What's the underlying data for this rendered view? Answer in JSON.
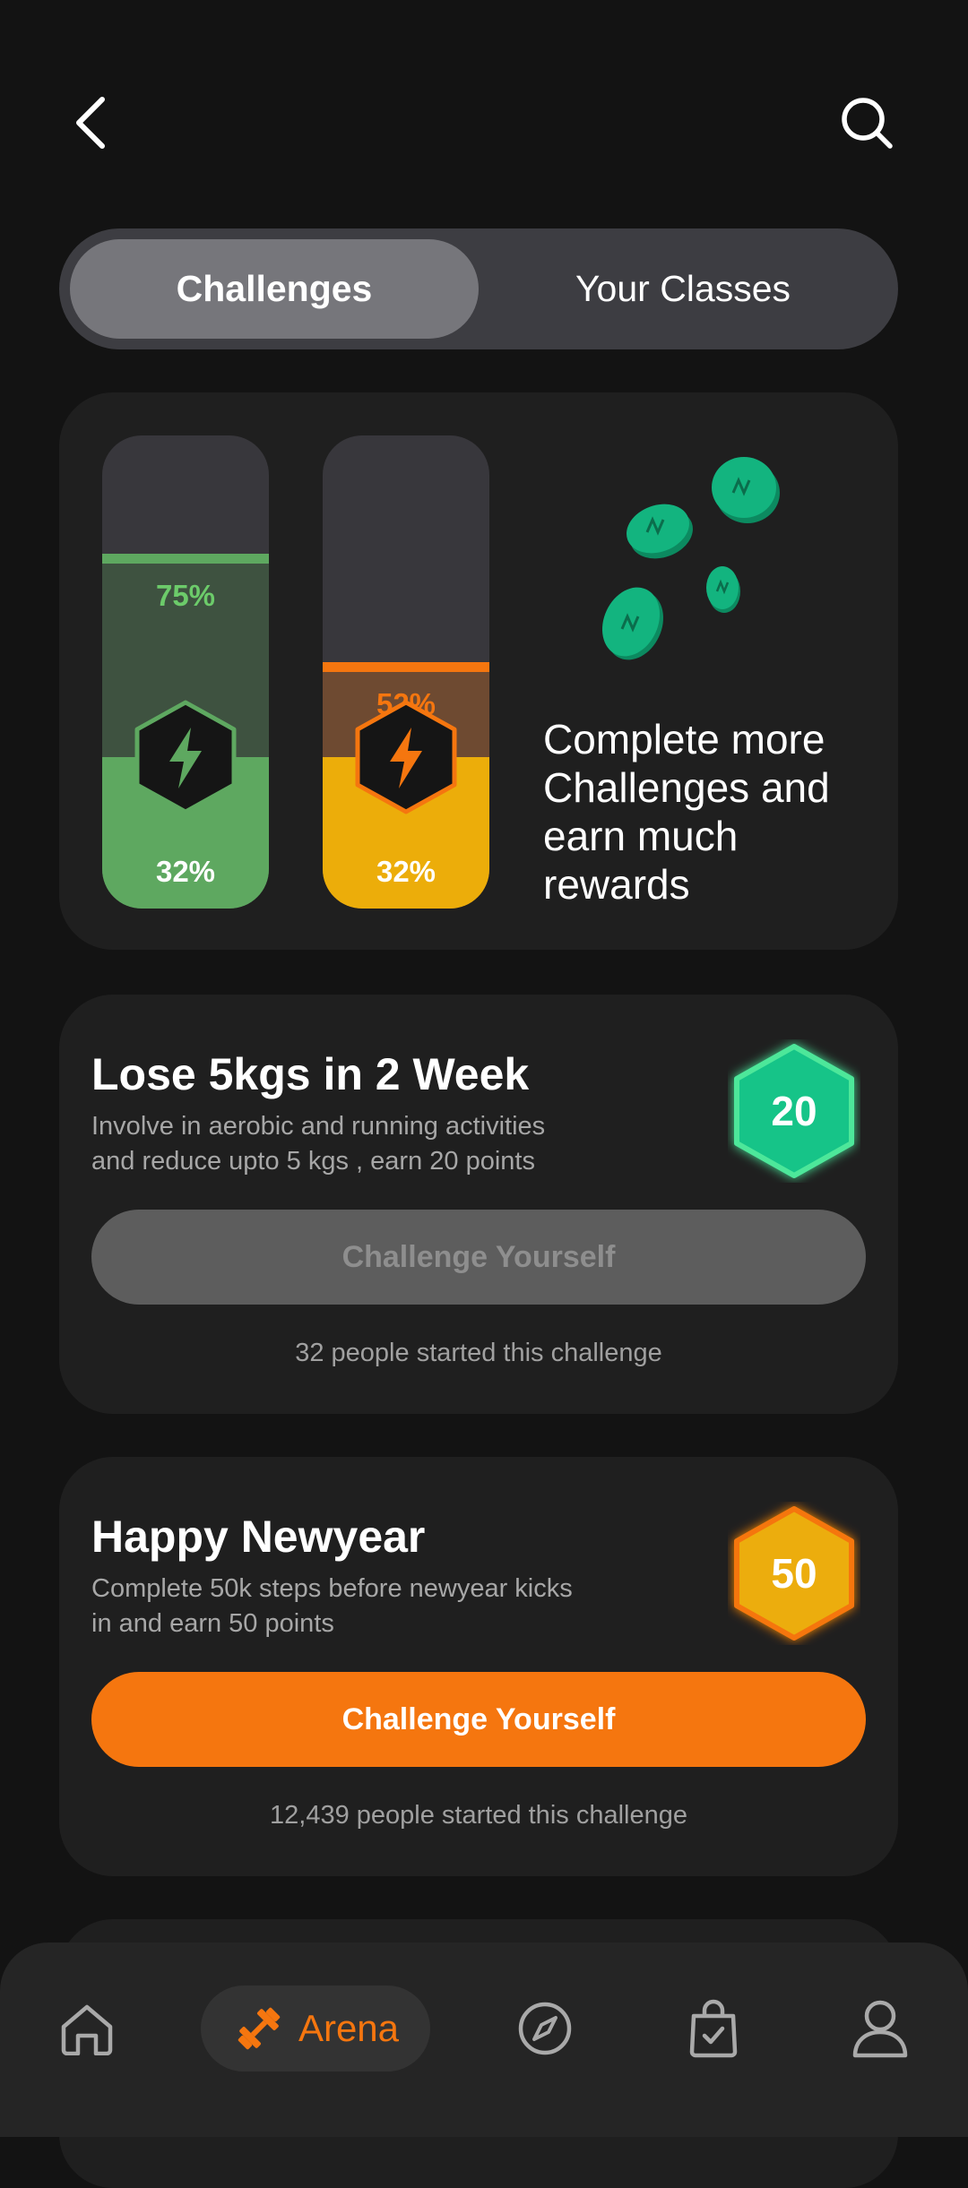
{
  "header": {
    "back_icon": "chevron-left-icon",
    "search_icon": "search-icon"
  },
  "tabs": [
    {
      "label": "Challenges",
      "active": true
    },
    {
      "label": "Your Classes",
      "active": false
    }
  ],
  "progress_card": {
    "bars": [
      {
        "goal_label": "75%",
        "goal_fraction": 0.75,
        "current_label": "32%",
        "current_fraction": 0.32,
        "color": "#5ea860",
        "goal_color": "#3e5240",
        "line_color": "#5ea860",
        "goal_text_color": "#6ccb6a",
        "icon": "lightning-bolt-icon"
      },
      {
        "goal_label": "52%",
        "goal_fraction": 0.52,
        "current_label": "32%",
        "current_fraction": 0.32,
        "color": "#ecad0a",
        "goal_color": "#6e4a31",
        "line_color": "#f5760f",
        "goal_text_color": "#f5760f",
        "icon": "lightning-bolt-icon"
      }
    ],
    "promo_text": "Complete more Challenges and earn much rewards",
    "coin_icon": "coin-icon",
    "coin_color": "#13b47f"
  },
  "challenges": [
    {
      "title": "Lose 5kgs in 2 Week",
      "description": "Involve in aerobic and running activities and reduce upto 5 kgs , earn 20 points",
      "points": "20",
      "badge_color": "#17c488",
      "badge_border": "#4ee79a",
      "button_label": "Challenge Yourself",
      "button_state": "disabled",
      "participants": "32 people started this challenge"
    },
    {
      "title": "Happy Newyear",
      "description": "Complete 50k steps before newyear kicks in and earn 50 points",
      "points": "50",
      "badge_color": "#ecad0a",
      "badge_border": "#f5760f",
      "button_label": "Challenge Yourself",
      "button_state": "primary",
      "participants": "12,439 people started this challenge"
    }
  ],
  "bottom_nav": {
    "items": [
      {
        "name": "home",
        "icon": "home-icon"
      },
      {
        "name": "arena",
        "icon": "dumbbell-icon",
        "label": "Arena",
        "active": true
      },
      {
        "name": "explore",
        "icon": "compass-icon"
      },
      {
        "name": "shop",
        "icon": "shopping-bag-icon"
      },
      {
        "name": "profile",
        "icon": "user-icon"
      }
    ],
    "active_color": "#f5760f"
  }
}
